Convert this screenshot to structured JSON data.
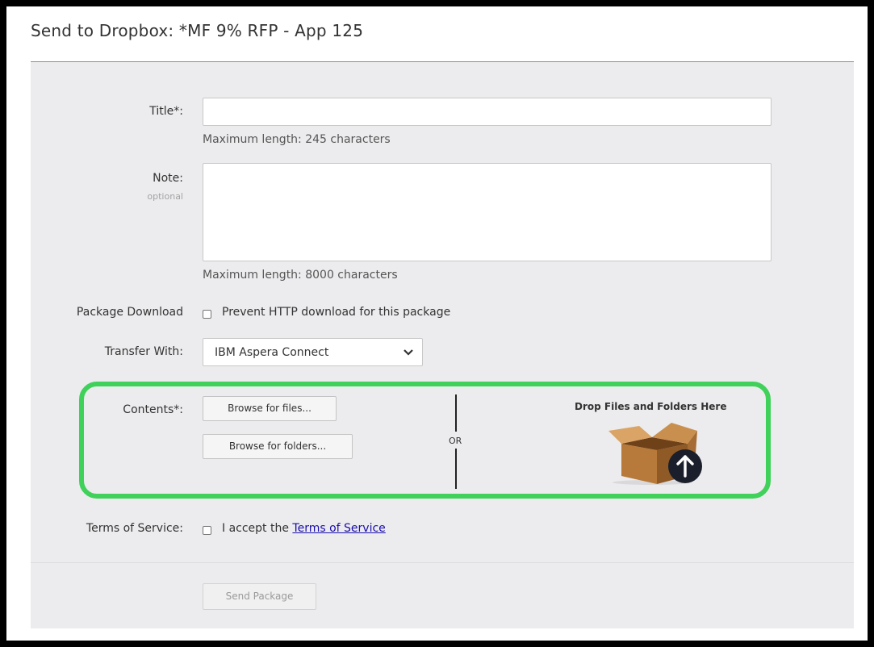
{
  "dialog": {
    "title": "Send to Dropbox: *MF 9% RFP - App 125"
  },
  "form": {
    "title_field": {
      "label": "Title*:",
      "value": "",
      "hint": "Maximum length: 245 characters"
    },
    "note_field": {
      "label": "Note:",
      "sublabel": "optional",
      "value": "",
      "hint": "Maximum length: 8000 characters"
    },
    "package_download": {
      "label": "Package Download",
      "checkbox_label": "Prevent HTTP download for this package",
      "checked": false
    },
    "transfer_with": {
      "label": "Transfer With:",
      "selected": "IBM Aspera Connect"
    },
    "contents": {
      "label": "Contents*:",
      "browse_files": "Browse for files...",
      "browse_folders": "Browse for folders...",
      "or_text": "OR",
      "drop_text": "Drop Files and Folders Here"
    },
    "terms": {
      "label": "Terms of Service:",
      "prefix": "I accept the",
      "link_text": "Terms of Service",
      "checked": false
    },
    "send_button": "Send Package"
  },
  "colors": {
    "highlight_border": "#3fd15a",
    "panel_background": "#ececee",
    "link": "#1a0dab",
    "upload_badge": "#1a1f2b"
  },
  "icons": {
    "dropdown": "chevron-down-icon",
    "dropzone": "box-upload-icon"
  }
}
